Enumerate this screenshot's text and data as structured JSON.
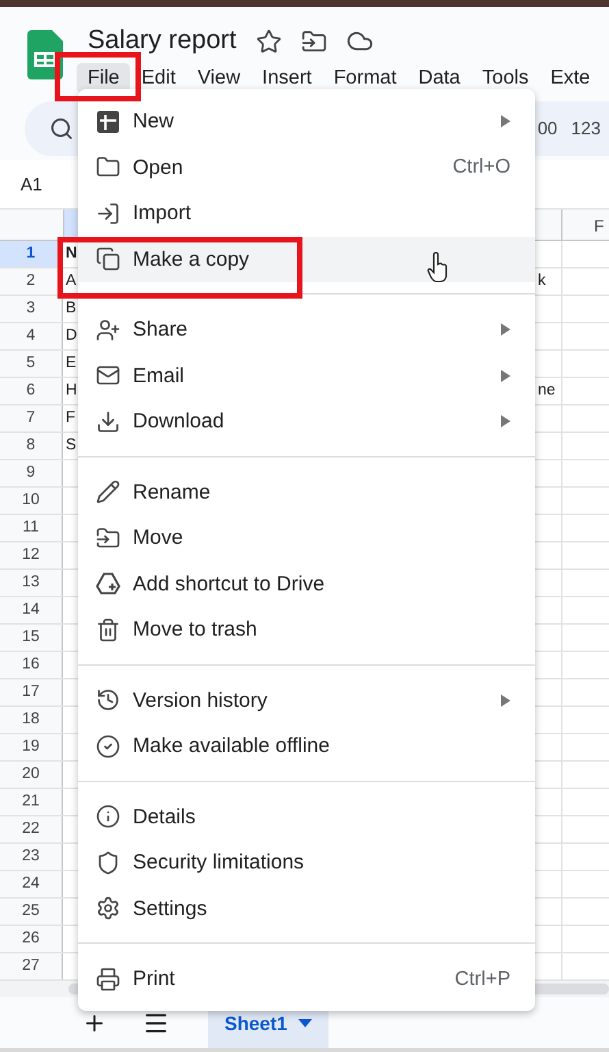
{
  "document": {
    "title": "Salary report"
  },
  "menubar": [
    {
      "label": "File",
      "selected": true,
      "highlighted": true
    },
    {
      "label": "Edit",
      "selected": false,
      "highlighted": false
    },
    {
      "label": "View",
      "selected": false,
      "highlighted": false
    },
    {
      "label": "Insert",
      "selected": false,
      "highlighted": false
    },
    {
      "label": "Format",
      "selected": false,
      "highlighted": false
    },
    {
      "label": "Data",
      "selected": false,
      "highlighted": false
    },
    {
      "label": "Tools",
      "selected": false,
      "highlighted": false
    },
    {
      "label": "Exte",
      "selected": false,
      "highlighted": false
    }
  ],
  "toolbar": {
    "decimal": "00",
    "format": "123"
  },
  "name_box": "A1",
  "column_header": "F",
  "rows": [
    {
      "number": "1",
      "cell_a": "N",
      "selected": true
    },
    {
      "number": "2",
      "cell_a": "A",
      "cell_e": "k",
      "selected": false
    },
    {
      "number": "3",
      "cell_a": "B",
      "selected": false
    },
    {
      "number": "4",
      "cell_a": "D",
      "selected": false
    },
    {
      "number": "5",
      "cell_a": "E",
      "selected": false
    },
    {
      "number": "6",
      "cell_a": "H",
      "cell_e": "ne",
      "selected": false
    },
    {
      "number": "7",
      "cell_a": "F",
      "selected": false
    },
    {
      "number": "8",
      "cell_a": "S",
      "selected": false
    },
    {
      "number": "9",
      "selected": false
    },
    {
      "number": "10",
      "selected": false
    },
    {
      "number": "11",
      "selected": false
    },
    {
      "number": "12",
      "selected": false
    },
    {
      "number": "13",
      "selected": false
    },
    {
      "number": "14",
      "selected": false
    },
    {
      "number": "15",
      "selected": false
    },
    {
      "number": "16",
      "selected": false
    },
    {
      "number": "17",
      "selected": false
    },
    {
      "number": "18",
      "selected": false
    },
    {
      "number": "19",
      "selected": false
    },
    {
      "number": "20",
      "selected": false
    },
    {
      "number": "21",
      "selected": false
    },
    {
      "number": "22",
      "selected": false
    },
    {
      "number": "23",
      "selected": false
    },
    {
      "number": "24",
      "selected": false
    },
    {
      "number": "25",
      "selected": false
    },
    {
      "number": "26",
      "selected": false
    },
    {
      "number": "27",
      "selected": false
    }
  ],
  "file_menu": [
    [
      {
        "label": "New",
        "submenu": true,
        "selected": false,
        "highlighted": false
      },
      {
        "label": "Open",
        "shortcut": "Ctrl+O",
        "submenu": false,
        "selected": false,
        "highlighted": false
      },
      {
        "label": "Import",
        "submenu": false,
        "selected": false,
        "highlighted": false
      },
      {
        "label": "Make a copy",
        "submenu": false,
        "selected": true,
        "highlighted": true
      }
    ],
    [
      {
        "label": "Share",
        "submenu": true,
        "selected": false,
        "highlighted": false
      },
      {
        "label": "Email",
        "submenu": true,
        "selected": false,
        "highlighted": false
      },
      {
        "label": "Download",
        "submenu": true,
        "selected": false,
        "highlighted": false
      }
    ],
    [
      {
        "label": "Rename",
        "submenu": false,
        "selected": false,
        "highlighted": false
      },
      {
        "label": "Move",
        "submenu": false,
        "selected": false,
        "highlighted": false
      },
      {
        "label": "Add shortcut to Drive",
        "submenu": false,
        "selected": false,
        "highlighted": false
      },
      {
        "label": "Move to trash",
        "submenu": false,
        "selected": false,
        "highlighted": false
      }
    ],
    [
      {
        "label": "Version history",
        "submenu": true,
        "selected": false,
        "highlighted": false
      },
      {
        "label": "Make available offline",
        "submenu": false,
        "selected": false,
        "highlighted": false
      }
    ],
    [
      {
        "label": "Details",
        "submenu": false,
        "selected": false,
        "highlighted": false
      },
      {
        "label": "Security limitations",
        "submenu": false,
        "selected": false,
        "highlighted": false
      },
      {
        "label": "Settings",
        "submenu": false,
        "selected": false,
        "highlighted": false
      }
    ],
    [
      {
        "label": "Print",
        "shortcut": "Ctrl+P",
        "submenu": false,
        "selected": false,
        "highlighted": false
      }
    ]
  ],
  "sheet_tabs": [
    {
      "label": "Sheet1",
      "selected": true
    }
  ]
}
